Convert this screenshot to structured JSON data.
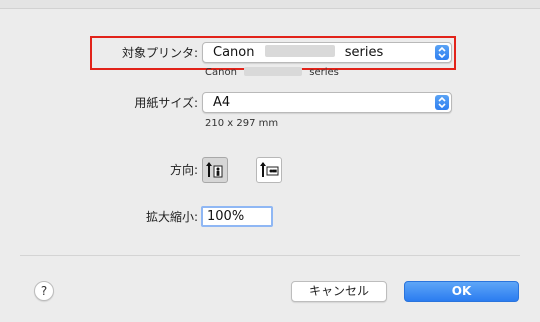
{
  "printer": {
    "label": "対象プリンタ:",
    "value_prefix": "Canon",
    "value_suffix": "series",
    "detail_prefix": "Canon",
    "detail_suffix": "series"
  },
  "paper": {
    "label": "用紙サイズ:",
    "value": "A4",
    "dimensions": "210 x 297 mm"
  },
  "orientation": {
    "label": "方向:",
    "selected": "portrait"
  },
  "scale": {
    "label": "拡大縮小:",
    "value": "100%"
  },
  "footer": {
    "help_label": "?",
    "cancel_label": "キャンセル",
    "ok_label": "OK"
  },
  "colors": {
    "highlight": "#e2231a",
    "accent": "#2f7ff0"
  }
}
